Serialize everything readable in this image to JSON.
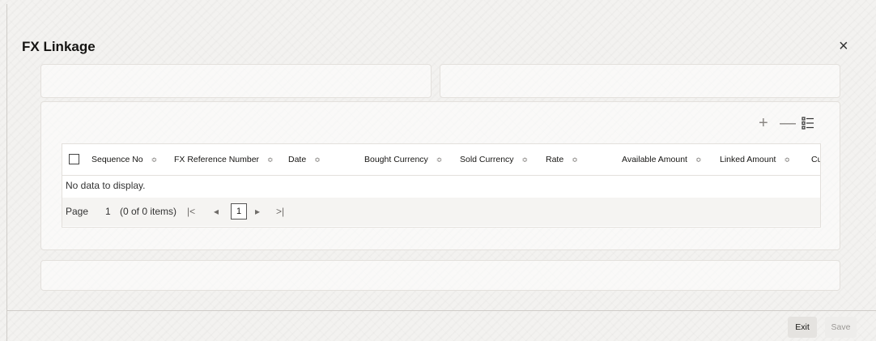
{
  "dialog": {
    "title": "FX Linkage",
    "close_icon": "×"
  },
  "toolbar": {
    "add_icon": "+",
    "remove_icon": "—"
  },
  "table": {
    "columns": [
      "Sequence No",
      "FX Reference Number",
      "Date",
      "Bought Currency",
      "Sold Currency",
      "Rate",
      "Available Amount",
      "Linked Amount",
      "Cu"
    ],
    "sort_icon": "≎",
    "empty_message": "No data to display."
  },
  "pagination": {
    "page_label": "Page",
    "page_value": "1",
    "items_info": "(0 of 0 items)",
    "first_icon": "|<",
    "prev_icon": "◂",
    "current": "1",
    "next_icon": "▸",
    "last_icon": ">|"
  },
  "footer": {
    "exit_label": "Exit",
    "save_label": "Save"
  }
}
